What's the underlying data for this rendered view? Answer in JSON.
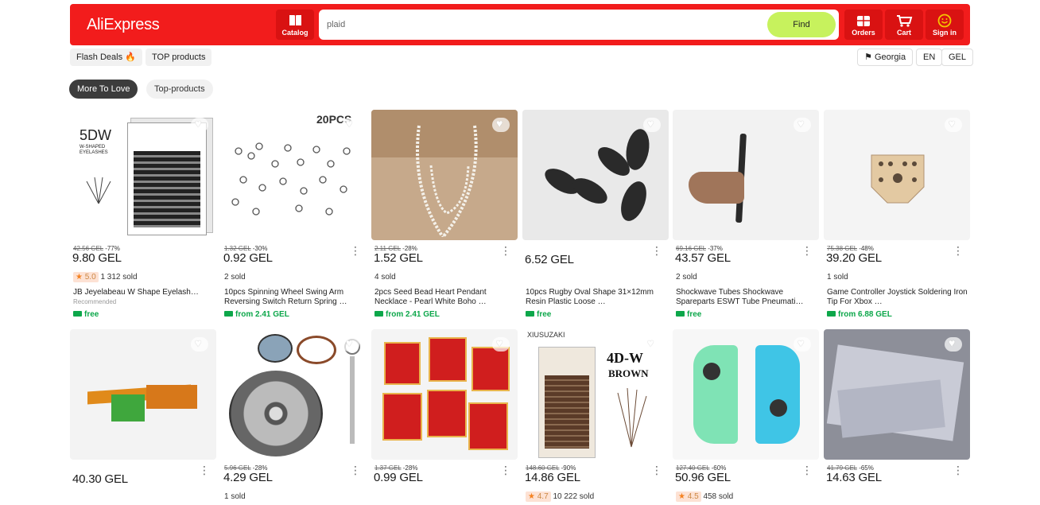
{
  "header": {
    "logo": "AliExpress",
    "catalog": "Catalog",
    "search_value": "plaid",
    "find": "Find",
    "orders": "Orders",
    "cart": "Cart",
    "signin": "Sign in"
  },
  "toolbar": {
    "flash": "Flash Deals 🔥",
    "top": "TOP products",
    "country": "Georgia",
    "lang": "EN",
    "currency": "GEL"
  },
  "tabs": [
    "More To Love",
    "Top-products"
  ],
  "products": [
    {
      "old": "42.56 GEL",
      "disc": "-77%",
      "price": "9.80 GEL",
      "rating": "5.0",
      "sold": "1 312 sold",
      "title": "JB Jeyelabeau W Shape Eyelash…",
      "sub": "Recommended",
      "ship": "free",
      "img_text": "5DW",
      "img_sub": "W-SHAPED EYELASHES"
    },
    {
      "old": "1.32 GEL",
      "disc": "-30%",
      "price": "0.92 GEL",
      "sold": "2 sold",
      "title": "10pcs Spinning Wheel Swing Arm Reversing Switch Return Spring …",
      "ship": "from 2.41 GEL",
      "img_text": "20PCS"
    },
    {
      "old": "2.11 GEL",
      "disc": "-28%",
      "price": "1.52 GEL",
      "sold": "4 sold",
      "title": "2pcs Seed Bead Heart Pendant Necklace - Pearl White  Boho …",
      "ship": "from 2.41 GEL"
    },
    {
      "price": "6.52 GEL",
      "title": "10pcs Rugby Oval Shape 31×12mm Resin Plastic Loose …",
      "ship": "free"
    },
    {
      "old": "69.16 GEL",
      "disc": "-37%",
      "price": "43.57 GEL",
      "sold": "2 sold",
      "title": "Shockwave Tubes Shockwave Spareparts ESWT Tube Pneumati…",
      "ship": "free"
    },
    {
      "old": "75.38 GEL",
      "disc": "-48%",
      "price": "39.20 GEL",
      "sold": "1 sold",
      "title": "Game Controller Joystick Soldering Iron Tip For Xbox …",
      "ship": "from 6.88 GEL"
    },
    {
      "price": "40.30 GEL"
    },
    {
      "old": "5.96 GEL",
      "disc": "-28%",
      "price": "4.29 GEL",
      "sold": "1 sold"
    },
    {
      "old": "1.37 GEL",
      "disc": "-28%",
      "price": "0.99 GEL"
    },
    {
      "old": "148.60 GEL",
      "disc": "-90%",
      "price": "14.86 GEL",
      "rating": "4.7",
      "sold": "10 222 sold",
      "img_text": "4D-W",
      "img_sub": "BROWN",
      "img_brand": "XIUSUZAKI"
    },
    {
      "old": "127.40 GEL",
      "disc": "-60%",
      "price": "50.96 GEL",
      "rating": "4.5",
      "sold": "458 sold"
    },
    {
      "old": "41.79 GEL",
      "disc": "-65%",
      "price": "14.63 GEL"
    }
  ]
}
